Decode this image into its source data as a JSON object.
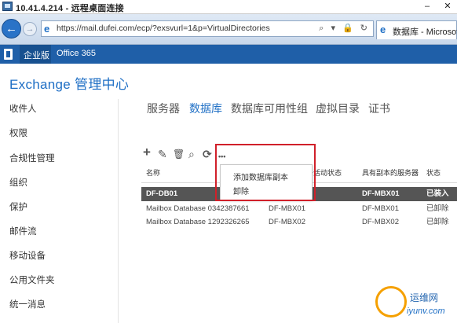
{
  "rdp": {
    "title": "10.41.4.214 - 远程桌面连接",
    "minimize": "–",
    "close": "✕"
  },
  "browser": {
    "back_icon": "arrow-left-icon",
    "url": "https://mail.dufei.com/ecp/?exsvurl=1&p=VirtualDirectories",
    "url_tools": "⌕ ▾ 🔒 ↻",
    "tab_label": "数据库 - Microsoft"
  },
  "o365": {
    "enterprise": "企业版",
    "office365": "Office 365"
  },
  "app_title": "Exchange 管理中心",
  "sidebar": {
    "items": [
      "收件人",
      "权限",
      "合规性管理",
      "组织",
      "保护",
      "邮件流",
      "移动设备",
      "公用文件夹",
      "统一消息"
    ]
  },
  "tabs": [
    "服务器",
    "数据库",
    "数据库可用性组",
    "虚拟目录",
    "证书"
  ],
  "active_tab": 1,
  "toolbar": {
    "add": "+",
    "edit": "✎",
    "delete": "🗑",
    "search": "⌕",
    "refresh": "⟳",
    "more": "•••",
    "icons": [
      "plus-icon",
      "pencil-icon",
      "trash-icon",
      "search-icon",
      "refresh-icon",
      "more-icon"
    ]
  },
  "more_menu": {
    "items": [
      "添加数据库副本",
      "卸除"
    ]
  },
  "grid": {
    "headers": [
      "名称",
      "",
      "于活动状态",
      "具有副本的服务器",
      "状态"
    ],
    "rows": [
      {
        "name": "DF-DB01",
        "active": "",
        "servers": "DF-MBX01",
        "status": "已装入",
        "selected": true
      },
      {
        "name": "Mailbox Database 0342387661",
        "active": "DF-MBX01",
        "servers": "DF-MBX01",
        "status": "已卸除",
        "selected": false
      },
      {
        "name": "Mailbox Database 1292326265",
        "active": "DF-MBX02",
        "servers": "DF-MBX02",
        "status": "已卸除",
        "selected": false
      }
    ]
  },
  "watermark": {
    "text1": "运维网",
    "text2": "iyunv.com"
  }
}
